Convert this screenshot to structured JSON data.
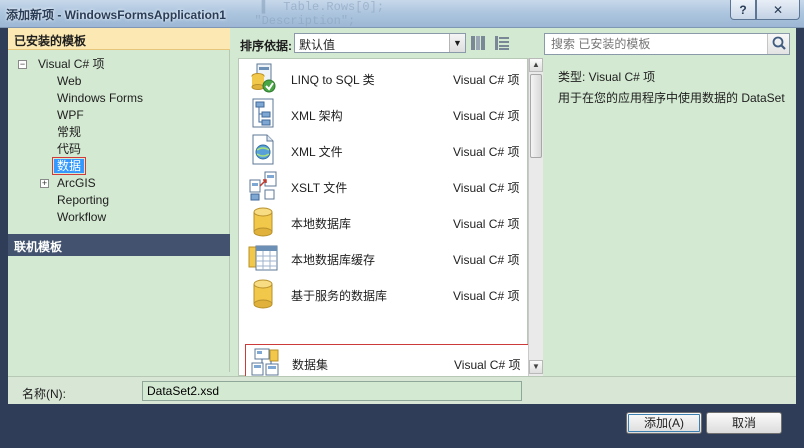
{
  "window": {
    "title": "添加新项 - WindowsFormsApplication1",
    "help_label": "?",
    "close_label": "✕"
  },
  "left_panel": {
    "installed_header": "已安装的模板",
    "tree": {
      "root_label": "Visual C# 项",
      "root_expander": "−",
      "children": [
        "Web",
        "Windows Forms",
        "WPF",
        "常规",
        "代码"
      ],
      "selected_label": "数据",
      "arcgis_expander": "+",
      "arcgis_label": "ArcGIS",
      "reporting_label": "Reporting",
      "workflow_label": "Workflow"
    },
    "online_header": "联机模板"
  },
  "toolbar": {
    "sort_label": "排序依据:",
    "sort_value": "默认值",
    "sort_arrow": "▼",
    "search_placeholder": "搜索 已安装的模板"
  },
  "templates": [
    {
      "name": "LINQ to SQL 类",
      "lang": "Visual C# 项",
      "icon": "linq-to-sql-icon"
    },
    {
      "name": "XML 架构",
      "lang": "Visual C# 项",
      "icon": "xml-schema-icon"
    },
    {
      "name": "XML 文件",
      "lang": "Visual C# 项",
      "icon": "xml-file-icon"
    },
    {
      "name": "XSLT 文件",
      "lang": "Visual C# 项",
      "icon": "xslt-file-icon"
    },
    {
      "name": "本地数据库",
      "lang": "Visual C# 项",
      "icon": "local-database-icon"
    },
    {
      "name": "本地数据库缓存",
      "lang": "Visual C# 项",
      "icon": "local-database-cache-icon"
    },
    {
      "name": "基于服务的数据库",
      "lang": "Visual C# 项",
      "icon": "service-database-icon"
    },
    {
      "name": "数据集",
      "lang": "Visual C# 项",
      "icon": "dataset-icon",
      "selected": true
    }
  ],
  "scrollbar": {
    "up": "▲",
    "down": "▼"
  },
  "details": {
    "type_line": "类型:  Visual C# 项",
    "description": "用于在您的应用程序中使用数据的 DataSet"
  },
  "name_field": {
    "label": "名称(N):",
    "value": "DataSet2.xsd"
  },
  "buttons": {
    "add": "添加(A)",
    "cancel": "取消"
  },
  "colors": {
    "panel_bg": "#d3e9d1",
    "installed_header_bg": "#fce8b2",
    "online_header_bg": "#43536f",
    "frame_bg": "#2f3d58",
    "selection_border": "#cc3a3a",
    "tree_selection_bg": "#3399ff"
  }
}
